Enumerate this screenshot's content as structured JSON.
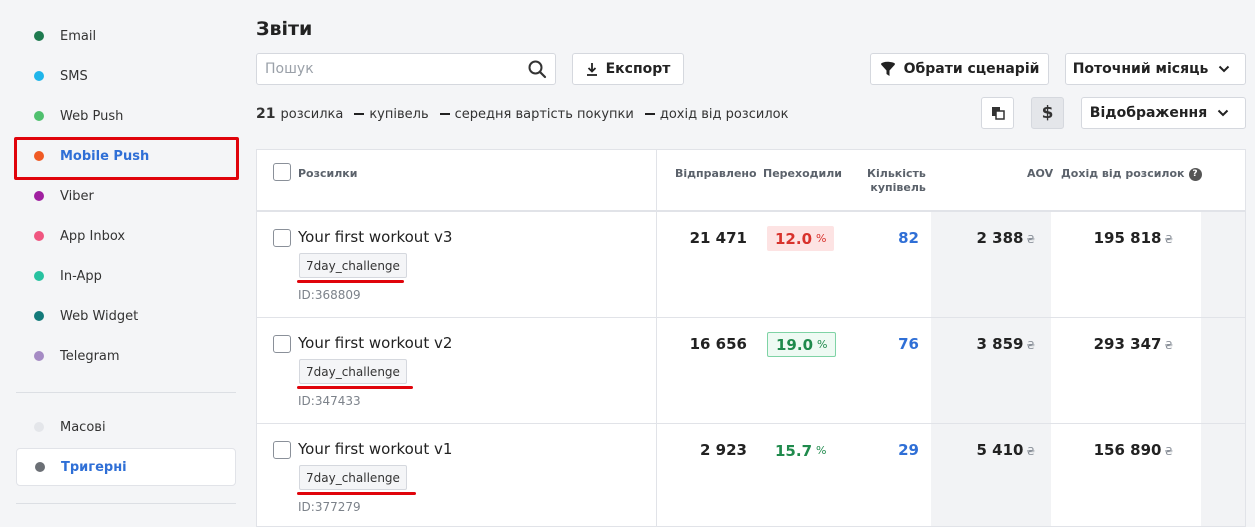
{
  "sidebar": {
    "channels": [
      {
        "label": "Email",
        "color": "#1e7a4f"
      },
      {
        "label": "SMS",
        "color": "#1fb5ea"
      },
      {
        "label": "Web Push",
        "color": "#4fc06e"
      },
      {
        "label": "Mobile Push",
        "color": "#f05a24"
      },
      {
        "label": "Viber",
        "color": "#a020a0"
      },
      {
        "label": "App Inbox",
        "color": "#f05680"
      },
      {
        "label": "In-App",
        "color": "#27c2a0"
      },
      {
        "label": "Web Widget",
        "color": "#137a7a"
      },
      {
        "label": "Telegram",
        "color": "#a58bc4"
      }
    ],
    "types": [
      {
        "label": "Масові",
        "color": "#e4e6ea"
      },
      {
        "label": "Тригерні",
        "color": "#6b6f75"
      }
    ]
  },
  "header": {
    "title": "Звіти",
    "search_placeholder": "Пошук",
    "export_label": "Експорт",
    "scenario_label": "Обрати сценарій",
    "period_label": "Поточний місяць",
    "display_label": "Відображення",
    "currency_symbol": "$"
  },
  "summary": {
    "count": "21",
    "count_label": "розсилка",
    "legend": [
      "купівель",
      "середня вартість покупки",
      "дохід від розсилок"
    ]
  },
  "table": {
    "headers": {
      "name": "Розсилки",
      "sent": "Відправлено",
      "clicked": "Переходили",
      "purchases_line1": "Кількість",
      "purchases_line2": "купівель",
      "aov": "AOV",
      "revenue": "Дохід від розсилок"
    },
    "rows": [
      {
        "name": "Your first workout v3",
        "tag": "7day_challenge",
        "id": "ID:368809",
        "sent": "21 471",
        "clicked": "12.0",
        "purchases": "82",
        "aov": "2 388",
        "revenue": "195 818"
      },
      {
        "name": "Your first workout v2",
        "tag": "7day_challenge",
        "id": "ID:347433",
        "sent": "16 656",
        "clicked": "19.0",
        "purchases": "76",
        "aov": "3 859",
        "revenue": "293 347"
      },
      {
        "name": "Your first workout v1",
        "tag": "7day_challenge",
        "id": "ID:377279",
        "sent": "2 923",
        "clicked": "15.7",
        "purchases": "29",
        "aov": "5 410",
        "revenue": "156 890"
      }
    ],
    "percent_unit": "%",
    "currency_unit": "₴"
  }
}
